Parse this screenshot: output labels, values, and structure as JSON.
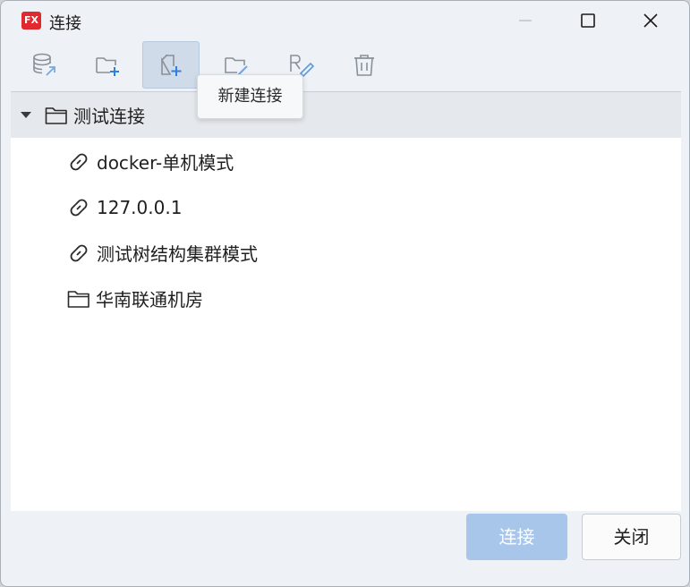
{
  "window": {
    "app_icon_text": "FX",
    "title": "连接"
  },
  "toolbar": {
    "buttons": [
      {
        "icon": "database-import-icon"
      },
      {
        "icon": "new-folder-icon"
      },
      {
        "icon": "new-connection-icon",
        "active": true
      },
      {
        "icon": "edit-folder-icon"
      },
      {
        "icon": "rename-icon"
      },
      {
        "icon": "trash-icon"
      }
    ],
    "tooltip": "新建连接"
  },
  "tree": {
    "root": {
      "label": "测试连接",
      "expanded": true,
      "selected": true
    },
    "children": [
      {
        "label": "docker-单机模式",
        "type": "connection"
      },
      {
        "label": "127.0.0.1",
        "type": "connection"
      },
      {
        "label": "测试树结构集群模式",
        "type": "connection"
      },
      {
        "label": "华南联通机房",
        "type": "folder"
      }
    ]
  },
  "footer": {
    "connect_label": "连接",
    "close_label": "关闭"
  },
  "colors": {
    "accent_disabled": "#a8c6ea",
    "app_icon": "#e02a2f",
    "toolbar_icon": "#8a9099",
    "plus_blue": "#2f7fe0"
  }
}
